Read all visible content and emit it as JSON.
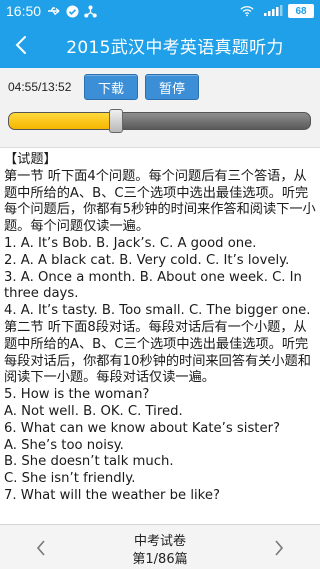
{
  "status_bar": {
    "time": "16:50",
    "icons": [
      "usb-icon",
      "check-circle-icon",
      "share-icon"
    ],
    "battery": "68"
  },
  "header": {
    "title": "2015武汉中考英语真题听力"
  },
  "player": {
    "time": "04:55/13:52",
    "download_label": "下载",
    "pause_label": "暂停",
    "progress": 0.355
  },
  "content": {
    "lines": [
      "【试题】",
      "第一节 听下面4个问题。每个问题后有三个答语，从题中所给的A、B、C三个选项中选出最佳选项。听完每个问题后，你都有5秒钟的时间来作答和阅读下一小题。每个问题仅读一遍。",
      "1. A. It’s Bob.      B. Jack’s.      C. A good one.",
      "2. A. A black cat.      B. Very cold.      C. It’s lovely.",
      "3. A. Once a month.      B. About one week.      C. In three days.",
      "4. A. It’s tasty.      B. Too small.      C. The bigger one.",
      "第二节 听下面8段对话。每段对话后有一个小题，从题中所给的A、B、C三个选项中选出最佳选项。听完每段对话后，你都有10秒钟的时间来回答有关小题和阅读下一小题。每段对话仅读一遍。",
      "5. How is the woman?",
      "A. Not well.      B. OK.      C. Tired.",
      "6. What can we know about Kate’s sister?",
      "A. She’s too noisy.",
      "B. She doesn’t talk much.",
      "C. She isn’t friendly.",
      "7. What will the weather be like?"
    ]
  },
  "footer": {
    "book_title": "中考试卷",
    "page_indicator": "第1/86篇"
  },
  "colors": {
    "accent": "#1fa0e8",
    "button": "#3c8fd6",
    "progress_fill": "#f5b600"
  }
}
